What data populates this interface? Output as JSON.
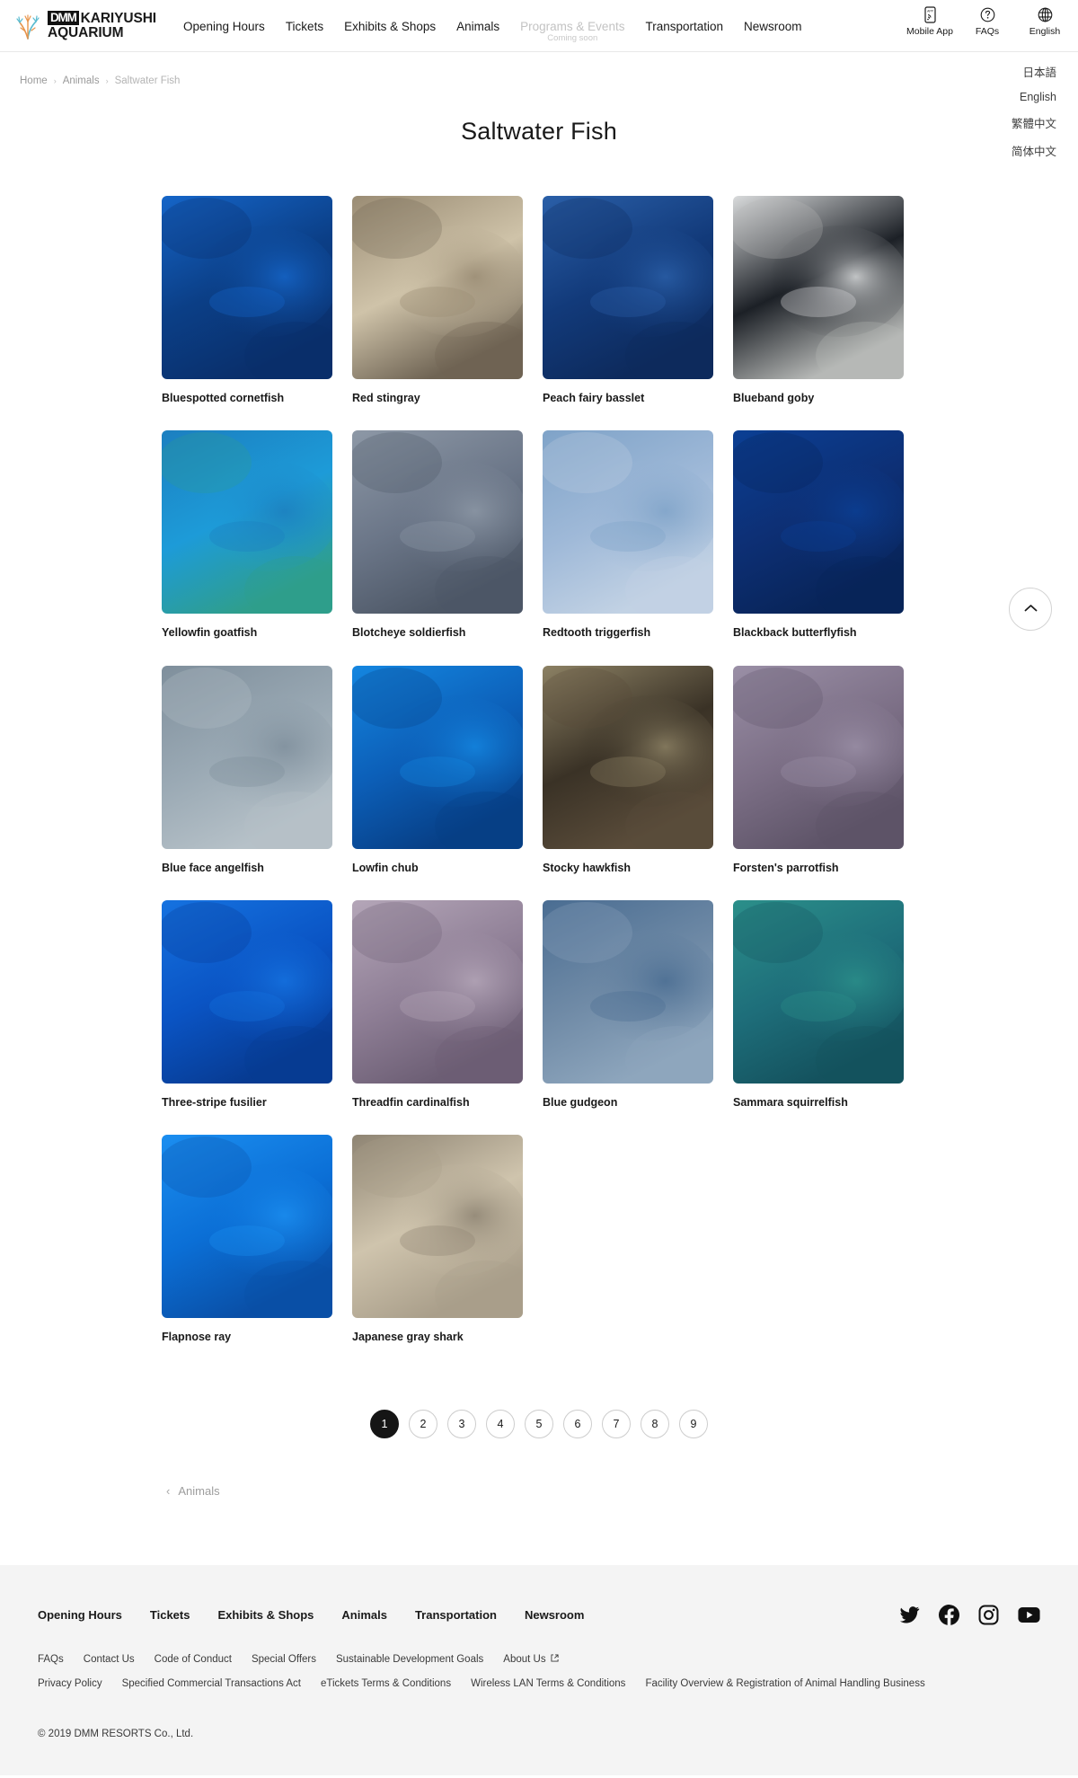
{
  "header": {
    "logo": {
      "badge": "DMM",
      "line1": "KARIYUSHI",
      "line2": "AQUARIUM",
      "icon": "coral-logo-icon"
    },
    "nav": [
      {
        "label": "Opening Hours",
        "disabled": false,
        "sub": ""
      },
      {
        "label": "Tickets",
        "disabled": false,
        "sub": ""
      },
      {
        "label": "Exhibits & Shops",
        "disabled": false,
        "sub": ""
      },
      {
        "label": "Animals",
        "disabled": false,
        "sub": ""
      },
      {
        "label": "Programs & Events",
        "disabled": true,
        "sub": "Coming soon"
      },
      {
        "label": "Transportation",
        "disabled": false,
        "sub": ""
      },
      {
        "label": "Newsroom",
        "disabled": false,
        "sub": ""
      }
    ],
    "utilities": [
      {
        "label": "Mobile App",
        "icon": "mobile-app-icon"
      },
      {
        "label": "FAQs",
        "icon": "question-circle-icon"
      },
      {
        "label": "English",
        "icon": "globe-icon"
      }
    ],
    "language_menu": [
      "日本語",
      "English",
      "繁體中文",
      "简体中文"
    ]
  },
  "breadcrumb": {
    "items": [
      "Home",
      "Animals",
      "Saltwater Fish"
    ],
    "separator": "›"
  },
  "page": {
    "title": "Saltwater Fish"
  },
  "cards": [
    {
      "label": "Bluespotted cornetfish",
      "image": "bluespotted-cornetfish",
      "c1": "#0b3f87",
      "c2": "#1565c8",
      "c3": "#0a2f6b"
    },
    {
      "label": "Red stingray",
      "image": "red-stingray",
      "c1": "#cfc3a9",
      "c2": "#9a8c74",
      "c3": "#6f6454"
    },
    {
      "label": "Peach fairy basslet",
      "image": "peach-fairy-basslet",
      "c1": "#123a7a",
      "c2": "#2a5fa8",
      "c3": "#0d2a5c"
    },
    {
      "label": "Blueband goby",
      "image": "blueband-goby",
      "c1": "#1c2026",
      "c2": "#d9dbdc",
      "c3": "#b6b8b6"
    },
    {
      "label": "Yellowfin goatfish",
      "image": "yellowfin-goatfish",
      "c1": "#1d9bd8",
      "c2": "#1c7fc0",
      "c3": "#2f9e8c"
    },
    {
      "label": "Blotcheye soldierfish",
      "image": "blotcheye-soldierfish",
      "c1": "#6b7688",
      "c2": "#8d98a6",
      "c3": "#4d5766"
    },
    {
      "label": "Redtooth triggerfish",
      "image": "redtooth-triggerfish",
      "c1": "#9fb9d8",
      "c2": "#7fa3c8",
      "c3": "#c2d2e4"
    },
    {
      "label": "Blackback butterflyfish",
      "image": "blackback-butterflyfish",
      "c1": "#0d2f74",
      "c2": "#0b3f94",
      "c3": "#082458"
    },
    {
      "label": "Blue face angelfish",
      "image": "blue-face-angelfish",
      "c1": "#9aa9b4",
      "c2": "#7f8f9c",
      "c3": "#b6c1c8"
    },
    {
      "label": "Lowfin chub",
      "image": "lowfin-chub",
      "c1": "#0c5fb8",
      "c2": "#1486e0",
      "c3": "#073f86"
    },
    {
      "label": "Stocky hawkfish",
      "image": "stocky-hawkfish",
      "c1": "#3a3226",
      "c2": "#8c8164",
      "c3": "#5a4c3a"
    },
    {
      "label": "Forsten's parrotfish",
      "image": "forstens-parrotfish",
      "c1": "#7c6f86",
      "c2": "#9a8fa6",
      "c3": "#5e5468"
    },
    {
      "label": "Three-stripe fusilier",
      "image": "three-stripe-fusilier",
      "c1": "#0a54c4",
      "c2": "#1572e0",
      "c3": "#073b92"
    },
    {
      "label": "Threadfin cardinalfish",
      "image": "threadfin-cardinalfish",
      "c1": "#8f7f96",
      "c2": "#b4a6b8",
      "c3": "#6c5e74"
    },
    {
      "label": "Blue gudgeon",
      "image": "blue-gudgeon",
      "c1": "#6f8aa6",
      "c2": "#4a6d92",
      "c3": "#8ea6bd"
    },
    {
      "label": "Sammara squirrelfish",
      "image": "sammara-squirrelfish",
      "c1": "#1e6e7a",
      "c2": "#2b8f8a",
      "c3": "#14525e"
    },
    {
      "label": "Flapnose ray",
      "image": "flapnose-ray",
      "c1": "#0b6fd6",
      "c2": "#1b8ef0",
      "c3": "#0a4fa6"
    },
    {
      "label": "Japanese gray shark",
      "image": "japanese-gray-shark",
      "c1": "#cfc4ad",
      "c2": "#8e8473",
      "c3": "#a99e8a"
    }
  ],
  "pagination": {
    "pages": [
      "1",
      "2",
      "3",
      "4",
      "5",
      "6",
      "7",
      "8",
      "9"
    ],
    "active": "1"
  },
  "back_link": {
    "label": "Animals",
    "chevron": "‹"
  },
  "scroll_top": {
    "icon": "chevron-up-icon"
  },
  "footer": {
    "nav": [
      "Opening Hours",
      "Tickets",
      "Exhibits & Shops",
      "Animals",
      "Transportation",
      "Newsroom"
    ],
    "social": [
      {
        "name": "twitter-icon"
      },
      {
        "name": "facebook-icon"
      },
      {
        "name": "instagram-icon"
      },
      {
        "name": "youtube-icon"
      }
    ],
    "links_row1": [
      {
        "label": "FAQs",
        "external": false
      },
      {
        "label": "Contact Us",
        "external": false
      },
      {
        "label": "Code of Conduct",
        "external": false
      },
      {
        "label": "Special Offers",
        "external": false
      },
      {
        "label": "Sustainable Development Goals",
        "external": false
      },
      {
        "label": "About Us",
        "external": true
      }
    ],
    "links_row2": [
      {
        "label": "Privacy Policy",
        "external": false
      },
      {
        "label": "Specified Commercial Transactions Act",
        "external": false
      },
      {
        "label": "eTickets Terms & Conditions",
        "external": false
      },
      {
        "label": "Wireless LAN Terms & Conditions",
        "external": false
      },
      {
        "label": "Facility Overview & Registration of Animal Handling Business",
        "external": false
      }
    ],
    "copyright": "© 2019 DMM RESORTS Co., Ltd."
  }
}
